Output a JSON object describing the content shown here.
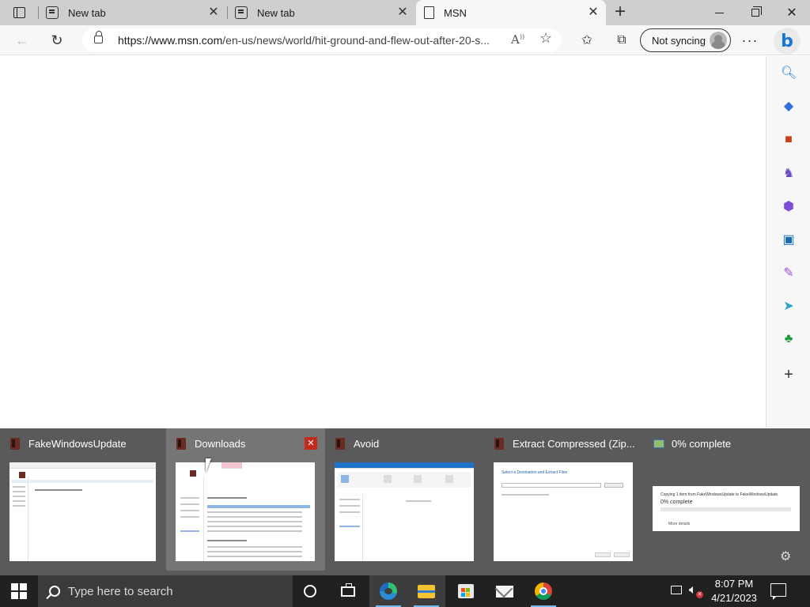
{
  "browser": {
    "tabs": [
      {
        "label": "New tab",
        "icon": "new-tab-page-icon"
      },
      {
        "label": "New tab",
        "icon": "new-tab-page-icon"
      },
      {
        "label": "MSN",
        "icon": "page-icon"
      }
    ],
    "active_tab_index": 2,
    "address": {
      "host": "https://www.msn.com",
      "path": "/en-us/news/world/hit-ground-and-flew-out-after-20-s..."
    },
    "profile_label": "Not syncing",
    "new_tab_symbol": "+",
    "close_symbol": "✕",
    "more_symbol": "···",
    "bing_letter": "b"
  },
  "sidebar": {
    "items": [
      {
        "icon": "search-icon",
        "color": "#1877d2"
      },
      {
        "icon": "shopping-tag-icon",
        "color": "#2f6fde"
      },
      {
        "icon": "tools-briefcase-icon",
        "color": "#c8401a"
      },
      {
        "icon": "games-chess-icon",
        "color": "#6a4bbd"
      },
      {
        "icon": "microsoft-365-icon",
        "color": "#7d4cd9"
      },
      {
        "icon": "outlook-icon",
        "color": "#0f6cbd"
      },
      {
        "icon": "drop-icon",
        "color": "#9b4ed8"
      },
      {
        "icon": "send-icon",
        "color": "#27a6c6"
      },
      {
        "icon": "tree-icon",
        "color": "#1c9a3a"
      },
      {
        "icon": "add-icon",
        "color": "#333333"
      }
    ]
  },
  "thumbnails": [
    {
      "title": "FakeWindowsUpdate",
      "icon": "app-icon",
      "hovered": false
    },
    {
      "title": "Downloads",
      "icon": "app-icon",
      "hovered": true
    },
    {
      "title": "Avoid",
      "icon": "app-icon",
      "hovered": false
    },
    {
      "title": "Extract Compressed (Zip...",
      "icon": "app-icon",
      "hovered": false
    },
    {
      "title": "0% complete",
      "icon": "copy-progress-icon",
      "hovered": false
    }
  ],
  "extract_preview": {
    "heading": "Select a Destination and Extract Files"
  },
  "progress_preview": {
    "line1": "Copying 1 item from FakeWindowsUpdate to FakeWindowsUpdate",
    "line2": "0% complete",
    "more": "More details"
  },
  "taskbar": {
    "search_placeholder": "Type here to search",
    "time": "8:07 PM",
    "date": "4/21/2023",
    "apps": [
      {
        "name": "cortana"
      },
      {
        "name": "task-view"
      },
      {
        "name": "edge",
        "active": true
      },
      {
        "name": "file-explorer",
        "running": true
      },
      {
        "name": "microsoft-store"
      },
      {
        "name": "mail"
      },
      {
        "name": "chrome",
        "running": true
      }
    ]
  }
}
